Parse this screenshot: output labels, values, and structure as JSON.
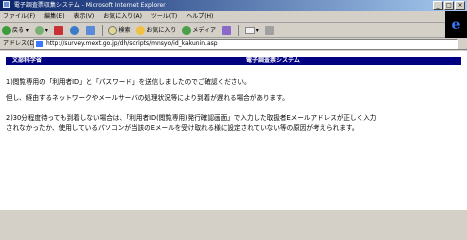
{
  "window": {
    "title": "電子調査票収集システム - Microsoft Internet Explorer",
    "buttons": [
      "_",
      "□",
      "×"
    ]
  },
  "menu": [
    "ファイル(F)",
    "編集(E)",
    "表示(V)",
    "お気に入り(A)",
    "ツール(T)",
    "ヘルプ(H)"
  ],
  "toolbar": {
    "back": "戻る",
    "search": "検索",
    "favorites": "お気に入り",
    "media": "メディア"
  },
  "address": {
    "label": "アドレス(D)",
    "url": "http://survey.mext.go.jp/dh/scripts/mnsyo/id_kakunin.asp"
  },
  "page": {
    "dept": "文部科学省",
    "system": "電子調査票システム",
    "para1": "1)閲覧専用の「利用者ID」と「パスワード」を送信しましたのでご確認ください。",
    "para2": "但し、経由するネットワークやメールサーバの処理状況等により到着が遅れる場合があります。",
    "para3a": "2)30分程度待っても到着しない場合は、「利用者ID(閲覧専用)発行確認画面」で入力した取扱者Eメールアドレスが正しく入力",
    "para3b": "されなかったか、使用しているパソコンが当該のEメールを受け取れる様に設定されていない等の原因が考えられます。"
  }
}
